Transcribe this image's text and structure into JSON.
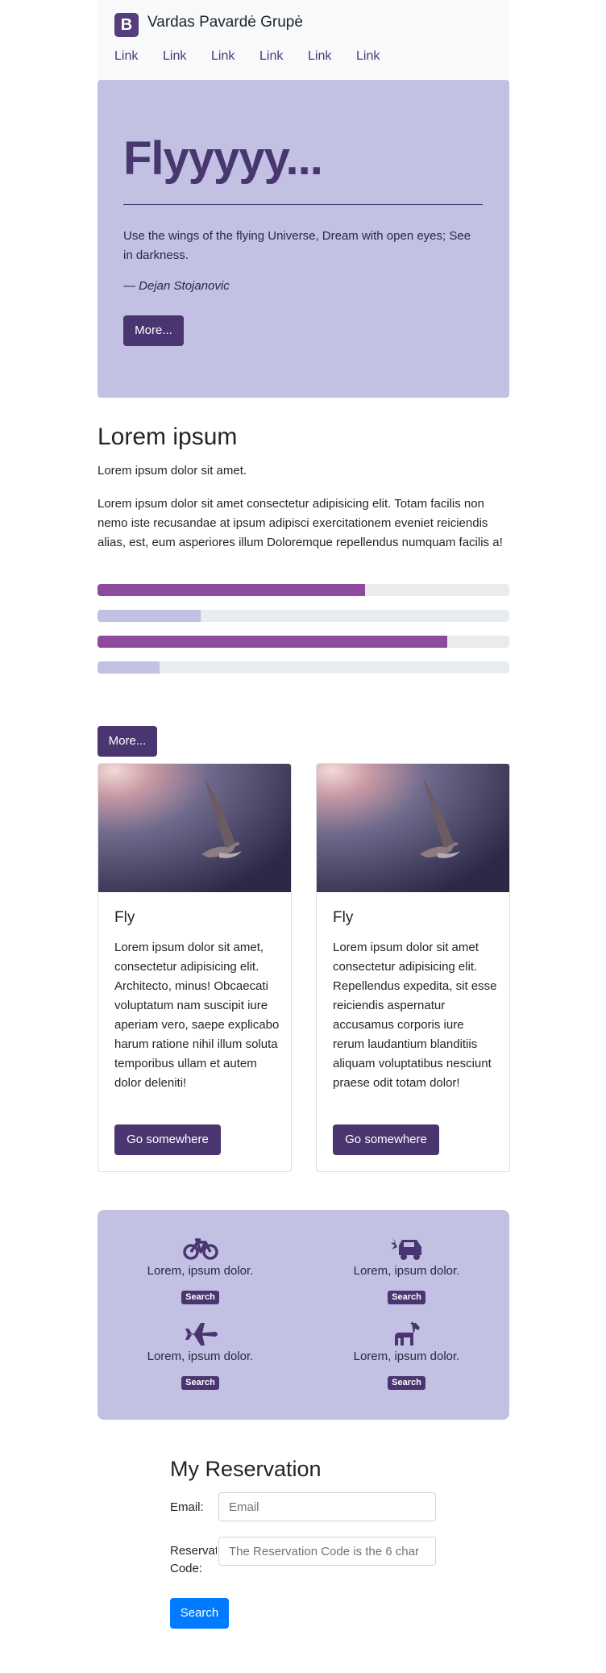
{
  "navbar": {
    "brand_letter": "B",
    "brand_name": "Vardas Pavardė Grupė",
    "links": [
      "Link",
      "Link",
      "Link",
      "Link",
      "Link",
      "Link"
    ]
  },
  "hero": {
    "title": "Flyyyyy...",
    "quote": "Use the wings of the flying Universe, Dream with open eyes; See in darkness.",
    "author": "— Dejan Stojanovic",
    "button": "More..."
  },
  "lorem": {
    "title": "Lorem ipsum",
    "lead": "Lorem ipsum dolor sit amet.",
    "body": "Lorem ipsum dolor sit amet consectetur adipisicing elit. Totam facilis non nemo iste recusandae at ipsum adipisci exercitationem eveniet reiciendis alias, est, eum asperiores illum Doloremque repellendus numquam facilis a!",
    "progress": [
      {
        "value": 0.65,
        "color": "#8e4a9e"
      },
      {
        "value": 0.25,
        "color": "#c2c0e3"
      },
      {
        "value": 0.85,
        "color": "#8e4a9e"
      },
      {
        "value": 0.15,
        "color": "#c2c0e3"
      }
    ],
    "button": "More..."
  },
  "cards": [
    {
      "title": "Fly",
      "text": "Lorem ipsum dolor sit amet, consectetur adipisicing elit. Architecto, minus! Obcaecati voluptatum nam suscipit iure aperiam vero, saepe explicabo harum ratione nihil illum soluta temporibus ullam et autem dolor deleniti!",
      "button": "Go somewhere"
    },
    {
      "title": "Fly",
      "text": "Lorem ipsum dolor sit amet consectetur adipisicing elit. Repellendus expedita, sit esse reiciendis aspernatur accusamus corporis iure rerum laudantium blanditiis aliquam voluptatibus nesciunt praese odit totam dolor!",
      "button": "Go somewhere"
    }
  ],
  "features": [
    {
      "icon": "bicycle-icon",
      "text": "Lorem, ipsum dolor.",
      "button": "Search"
    },
    {
      "icon": "car-crash-icon",
      "text": "Lorem, ipsum dolor.",
      "button": "Search"
    },
    {
      "icon": "plane-icon",
      "text": "Lorem, ipsum dolor.",
      "button": "Search"
    },
    {
      "icon": "horse-icon",
      "text": "Lorem, ipsum dolor.",
      "button": "Search"
    }
  ],
  "reservation": {
    "title": "My Reservation",
    "email_label": "Email:",
    "email_placeholder": "Email",
    "code_label": "Reservation Code:",
    "code_placeholder": "The Reservation Code is the 6 char",
    "button": "Search"
  },
  "colors": {
    "brand": "#563d7c",
    "accent": "#4a3571",
    "hero_bg": "#c2c0e3",
    "progress_strong": "#8e4a9e",
    "primary_button": "#007bff"
  }
}
